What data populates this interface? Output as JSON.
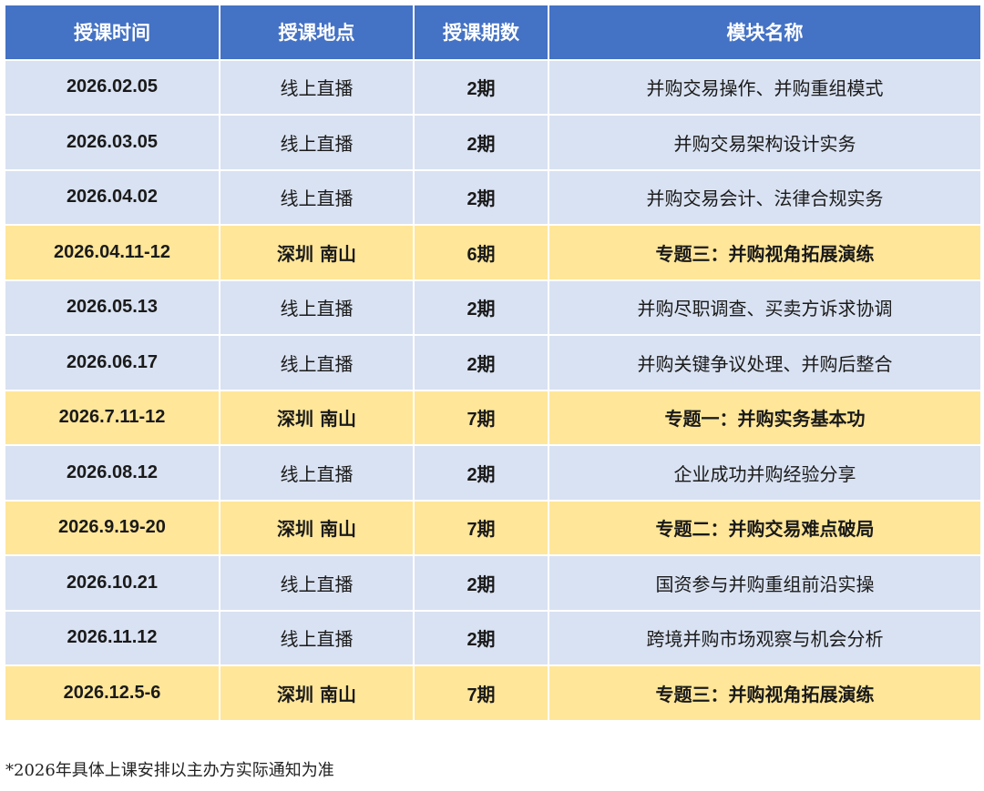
{
  "table": {
    "headers": [
      "授课时间",
      "授课地点",
      "授课期数",
      "模块名称"
    ],
    "rows": [
      {
        "date": "2026.02.05",
        "location": "线上直播",
        "periods": "2期",
        "module": "并购交易操作、并购重组模式",
        "type": "online"
      },
      {
        "date": "2026.03.05",
        "location": "线上直播",
        "periods": "2期",
        "module": "并购交易架构设计实务",
        "type": "online"
      },
      {
        "date": "2026.04.02",
        "location": "线上直播",
        "periods": "2期",
        "module": "并购交易会计、法律合规实务",
        "type": "online"
      },
      {
        "date": "2026.04.11-12",
        "location": "深圳 南山",
        "periods": "6期",
        "module": "专题三：并购视角拓展演练",
        "type": "offline"
      },
      {
        "date": "2026.05.13",
        "location": "线上直播",
        "periods": "2期",
        "module": "并购尽职调查、买卖方诉求协调",
        "type": "online"
      },
      {
        "date": "2026.06.17",
        "location": "线上直播",
        "periods": "2期",
        "module": "并购关键争议处理、并购后整合",
        "type": "online"
      },
      {
        "date": "2026.7.11-12",
        "location": "深圳 南山",
        "periods": "7期",
        "module": "专题一：并购实务基本功",
        "type": "offline"
      },
      {
        "date": "2026.08.12",
        "location": "线上直播",
        "periods": "2期",
        "module": "企业成功并购经验分享",
        "type": "online"
      },
      {
        "date": "2026.9.19-20",
        "location": "深圳 南山",
        "periods": "7期",
        "module": "专题二：并购交易难点破局",
        "type": "offline"
      },
      {
        "date": "2026.10.21",
        "location": "线上直播",
        "periods": "2期",
        "module": "国资参与并购重组前沿实操",
        "type": "online"
      },
      {
        "date": "2026.11.12",
        "location": "线上直播",
        "periods": "2期",
        "module": "跨境并购市场观察与机会分析",
        "type": "online"
      },
      {
        "date": "2026.12.5-6",
        "location": "深圳 南山",
        "periods": "7期",
        "module": "专题三：并购视角拓展演练",
        "type": "offline"
      }
    ]
  },
  "footnote": "*2026年具体上课安排以主办方实际通知为准",
  "colors": {
    "header_bg": "#4472c4",
    "online_row_bg": "#d9e2f2",
    "offline_row_bg": "#ffe699"
  }
}
